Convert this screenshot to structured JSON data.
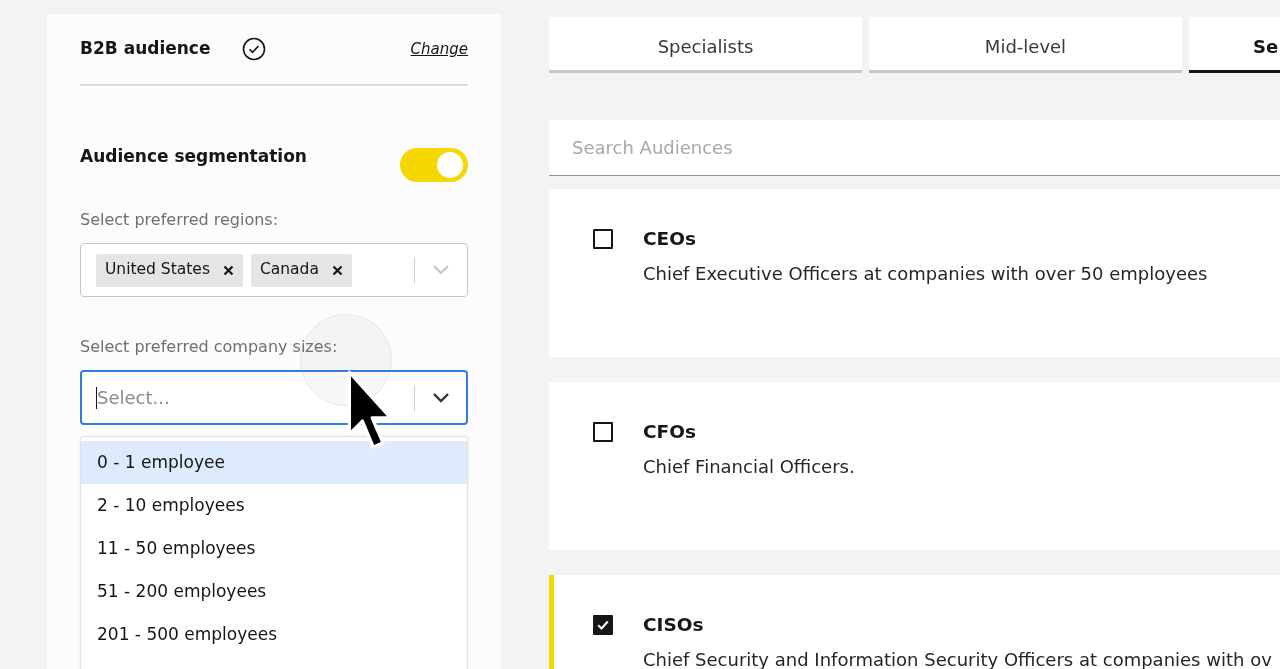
{
  "panel": {
    "title": "B2B audience",
    "verified": true,
    "change_link": "Change"
  },
  "segmentation": {
    "title": "Audience segmentation",
    "on": true,
    "regions": {
      "label": "Select preferred regions:",
      "values": [
        "United States",
        "Canada"
      ]
    },
    "company_sizes": {
      "label": "Select preferred company sizes:",
      "placeholder": "Select...",
      "focused": true,
      "options": [
        {
          "label": "0 - 1 employee",
          "highlighted": true
        },
        {
          "label": "2 - 10 employees",
          "highlighted": false
        },
        {
          "label": "11 - 50 employees",
          "highlighted": false
        },
        {
          "label": "51 - 200 employees",
          "highlighted": false
        },
        {
          "label": "201 - 500 employees",
          "highlighted": false
        }
      ]
    }
  },
  "tabs": [
    {
      "label": "Specialists",
      "selected": false
    },
    {
      "label": "Mid-level",
      "selected": false
    },
    {
      "label": "Se",
      "selected": true
    }
  ],
  "search": {
    "placeholder": "Search Audiences"
  },
  "audiences": [
    {
      "title": "CEOs",
      "description": "Chief Executive Officers at companies with over 50 employees",
      "checked": false
    },
    {
      "title": "CFOs",
      "description": "Chief Financial Officers.",
      "checked": false
    },
    {
      "title": "CISOs",
      "description": "Chief Security and Information Security Officers at companies with ov",
      "checked": true
    }
  ]
}
